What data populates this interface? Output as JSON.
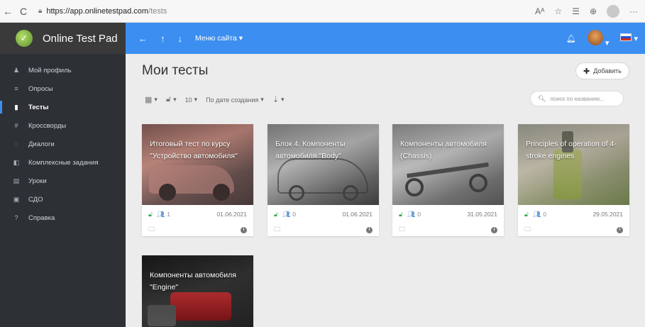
{
  "browser": {
    "back": "←",
    "reload": "C",
    "url_host": "https://app.onlinetestpad.com",
    "url_path": "/tests",
    "icons": [
      "read-aloud-icon",
      "favorites-add-icon",
      "favorites-icon",
      "collections-icon",
      "profile-icon",
      "more-icon"
    ]
  },
  "brand": {
    "name": "Online Test Pad"
  },
  "topbar": {
    "back_icon": "←",
    "up_icon": "↑",
    "down_icon": "↓",
    "site_menu": "Меню сайта",
    "accent": "#3c8ff0"
  },
  "sidebar": {
    "items": [
      {
        "label": "Мой профиль",
        "icon": "user-icon",
        "glyph": "♟"
      },
      {
        "label": "Опросы",
        "icon": "poll-icon",
        "glyph": "≡"
      },
      {
        "label": "Тесты",
        "icon": "test-icon",
        "glyph": "▮",
        "active": true
      },
      {
        "label": "Кроссворды",
        "icon": "crossword-icon",
        "glyph": "#"
      },
      {
        "label": "Диалоги",
        "icon": "dialog-icon",
        "glyph": "◌"
      },
      {
        "label": "Комплексные задания",
        "icon": "complex-task-icon",
        "glyph": "◧"
      },
      {
        "label": "Уроки",
        "icon": "lessons-icon",
        "glyph": "▤"
      },
      {
        "label": "СДО",
        "icon": "lms-icon",
        "glyph": "▣"
      },
      {
        "label": "Справка",
        "icon": "help-icon",
        "glyph": "?"
      }
    ]
  },
  "main": {
    "title": "Мои тесты",
    "add_label": "Добавить",
    "toolbar": {
      "page_size": "10",
      "sort": "По дате создания"
    },
    "search_placeholder": "поиск по названию..."
  },
  "cards": [
    {
      "title": "Итоговый тест по курсу \"Устройство автомобиля\"",
      "count": "1",
      "date": "01.06.2021",
      "palette": [
        "#8a5a55",
        "#c97f74",
        "#5b4b4a"
      ]
    },
    {
      "title": "Блок 4. Компоненты автомобиля \"Body\"",
      "count": "0",
      "date": "01.06.2021",
      "palette": [
        "#7d7d7d",
        "#a9a9a9",
        "#4d4d4d"
      ]
    },
    {
      "title": "Компоненты автомобиля (Chassis)",
      "count": "0",
      "date": "31.05.2021",
      "palette": [
        "#8f8f8f",
        "#c4c4c4",
        "#5a5a5a"
      ]
    },
    {
      "title": "Principles of operation of 4-stroke engines",
      "count": "0",
      "date": "29.05.2021",
      "palette": [
        "#8a9b6a",
        "#c9a560",
        "#556b3c"
      ]
    },
    {
      "title": "Компоненты автомобиля \"Engine\"",
      "count": "",
      "date": "",
      "palette": [
        "#2b2b2b",
        "#b8262a",
        "#4a4a4a"
      ]
    }
  ]
}
